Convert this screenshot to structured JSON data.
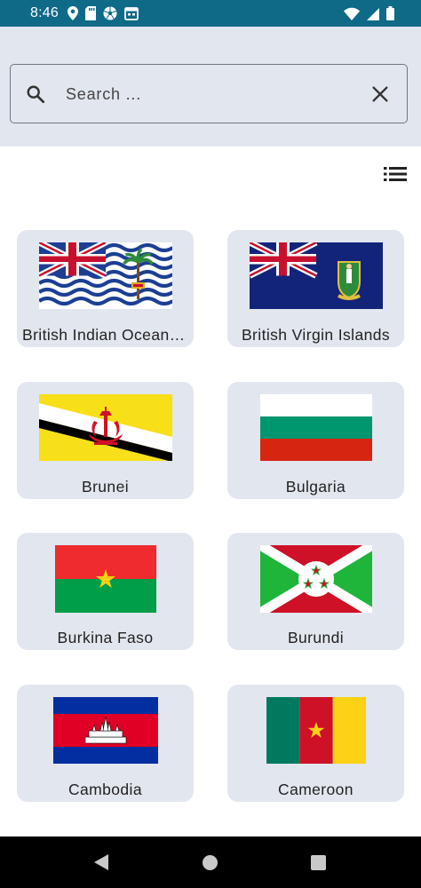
{
  "status_bar": {
    "time": "8:46",
    "left_icons": [
      "location-icon",
      "sd-card-icon",
      "soccer-ball-icon",
      "calendar-icon"
    ],
    "right_icons": [
      "wifi-icon",
      "cellular-signal-icon",
      "battery-icon"
    ]
  },
  "search": {
    "placeholder": "Search ...",
    "value": ""
  },
  "countries": [
    {
      "name": "British Indian Ocean Territory",
      "flag": "british-indian-ocean-territory-flag"
    },
    {
      "name": "British Virgin Islands",
      "flag": "british-virgin-islands-flag"
    },
    {
      "name": "Brunei",
      "flag": "brunei-flag"
    },
    {
      "name": "Bulgaria",
      "flag": "bulgaria-flag"
    },
    {
      "name": "Burkina Faso",
      "flag": "burkina-faso-flag"
    },
    {
      "name": "Burundi",
      "flag": "burundi-flag"
    },
    {
      "name": "Cambodia",
      "flag": "cambodia-flag"
    },
    {
      "name": "Cameroon",
      "flag": "cameroon-flag"
    }
  ],
  "colors": {
    "status_bar": "#0e6a87",
    "surface": "#e2e6ee"
  }
}
